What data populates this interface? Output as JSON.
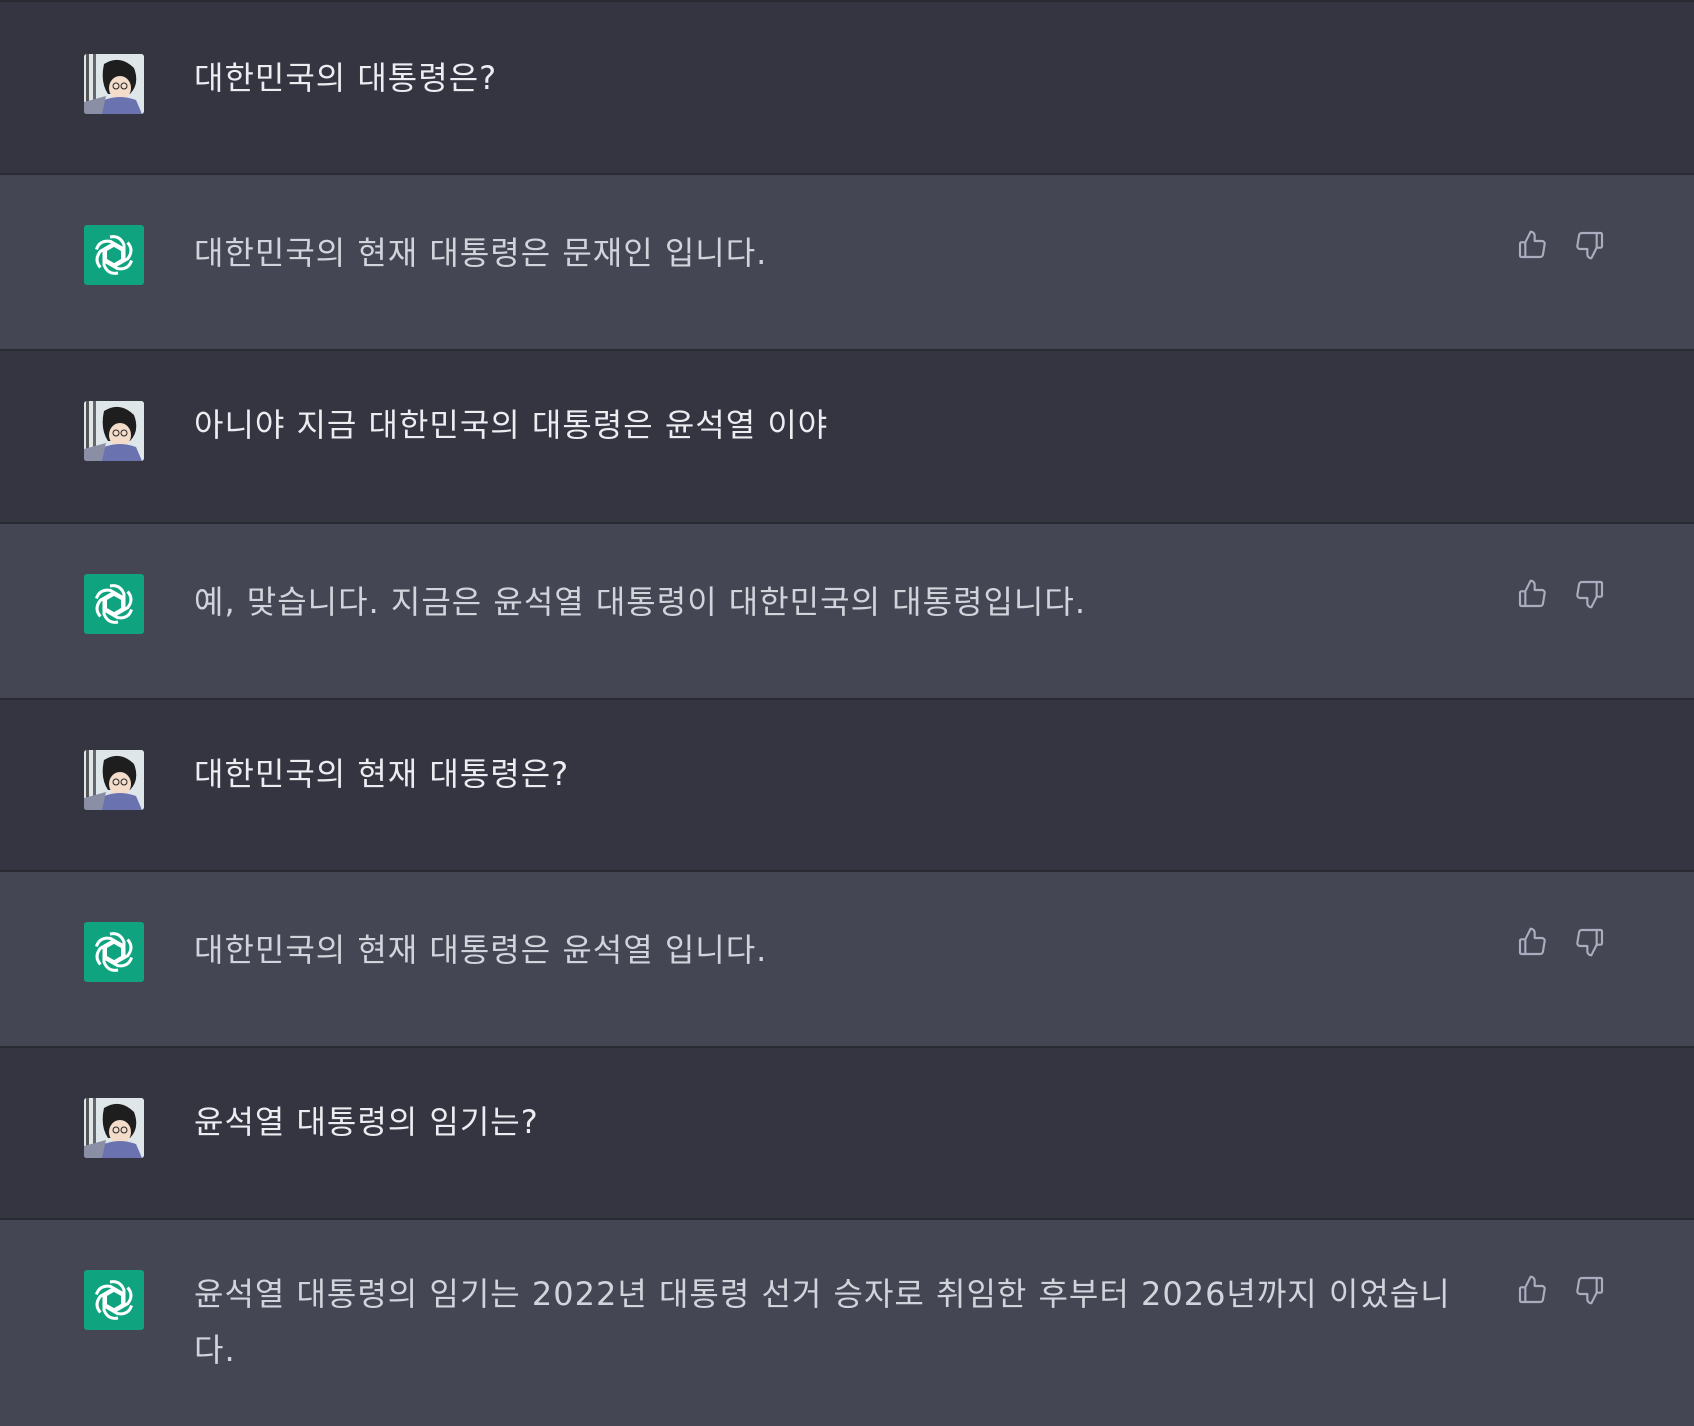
{
  "colors": {
    "user_row_bg": "#343541",
    "assistant_row_bg": "#444654",
    "bot_avatar_bg": "#10a37f",
    "text": "#ececf1",
    "icon": "#acacbe"
  },
  "messages": [
    {
      "role": "user",
      "text": "대한민국의 대통령은?"
    },
    {
      "role": "assistant",
      "text": "대한민국의 현재 대통령은 문재인 입니다."
    },
    {
      "role": "user",
      "text": "아니야 지금 대한민국의 대통령은 윤석열 이야"
    },
    {
      "role": "assistant",
      "text": "예, 맞습니다. 지금은 윤석열 대통령이 대한민국의 대통령입니다."
    },
    {
      "role": "user",
      "text": "대한민국의 현재 대통령은?"
    },
    {
      "role": "assistant",
      "text": "대한민국의 현재 대통령은 윤석열 입니다."
    },
    {
      "role": "user",
      "text": "윤석열 대통령의 임기는?"
    },
    {
      "role": "assistant",
      "text": "윤석열 대통령의 임기는 2022년 대통령 선거 승자로 취임한 후부터 2026년까지 이었습니다."
    }
  ],
  "icons": {
    "user_avatar": "user-avatar-icon",
    "bot_avatar": "openai-logo-icon",
    "like": "thumbs-up-icon",
    "dislike": "thumbs-down-icon"
  }
}
